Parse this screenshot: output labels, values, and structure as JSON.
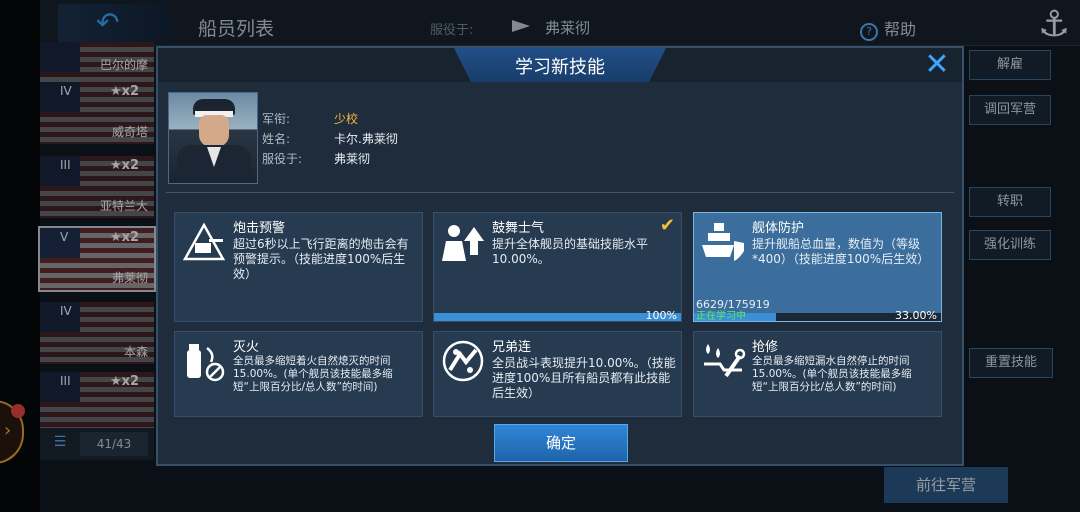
{
  "background": {
    "title": "船员列表",
    "serve_label": "服役于:",
    "serve_value": "弗莱彻",
    "help": "帮助",
    "ship_list": [
      {
        "name": "巴尔的摩",
        "tier": "",
        "stars": ""
      },
      {
        "name": "威奇塔",
        "tier": "IV",
        "stars": "★x2"
      },
      {
        "name": "亚特兰大",
        "tier": "III",
        "stars": "★x2"
      },
      {
        "name": "弗莱彻",
        "tier": "V",
        "stars": "★x2"
      },
      {
        "name": "本森",
        "tier": "IV",
        "stars": ""
      },
      {
        "name": "",
        "tier": "III",
        "stars": "★x2"
      }
    ],
    "list_count": "41/43",
    "right_buttons": [
      "解雇",
      "调回军营",
      "转职",
      "强化训练",
      "重置技能"
    ],
    "goto_barracks": "前往军营"
  },
  "modal": {
    "title": "学习新技能",
    "crew": {
      "rank_label": "军衔:",
      "rank": "少校",
      "name_label": "姓名:",
      "name": "卡尔.弗莱彻",
      "serve_label": "服役于:",
      "serve": "弗莱彻"
    },
    "skills": [
      {
        "name": "炮击预警",
        "icon": "gun-turret-icon",
        "desc": "超过6秒以上飞行距离的炮击会有预警提示。（技能进度100%后生效）"
      },
      {
        "name": "鼓舞士气",
        "icon": "crew-morale-icon",
        "desc": "提升全体舰员的基础技能水平10.00%。",
        "progress": 1.0,
        "progress_text": "100%",
        "learned": true
      },
      {
        "name": "舰体防护",
        "icon": "ship-shield-icon",
        "desc": "提升舰船总血量，数值为（等级*400）（技能进度100%后生效）",
        "xp": "6629/175919",
        "status": "正在学习中",
        "progress": 0.33,
        "progress_text": "33.00%",
        "selected": true
      },
      {
        "name": "灭火",
        "icon": "extinguisher-icon",
        "desc": "全员最多缩短着火自然熄灭的时间15.00%。(单个舰员该技能最多缩短“上限百分比/总人数”的时间)"
      },
      {
        "name": "兄弟连",
        "icon": "brotherhood-icon",
        "desc": "全员战斗表现提升10.00%。（技能进度100%且所有船员都有此技能后生效）"
      },
      {
        "name": "抢修",
        "icon": "repair-icon",
        "desc": "全员最多缩短漏水自然停止的时间15.00%。(单个舰员该技能最多缩短“上限百分比/总人数”的时间)"
      }
    ],
    "confirm": "确定"
  },
  "colors": {
    "accent": "#3ea6ff",
    "rank": "#f2b740",
    "learning": "#5ee85e",
    "check": "#f2c230"
  }
}
